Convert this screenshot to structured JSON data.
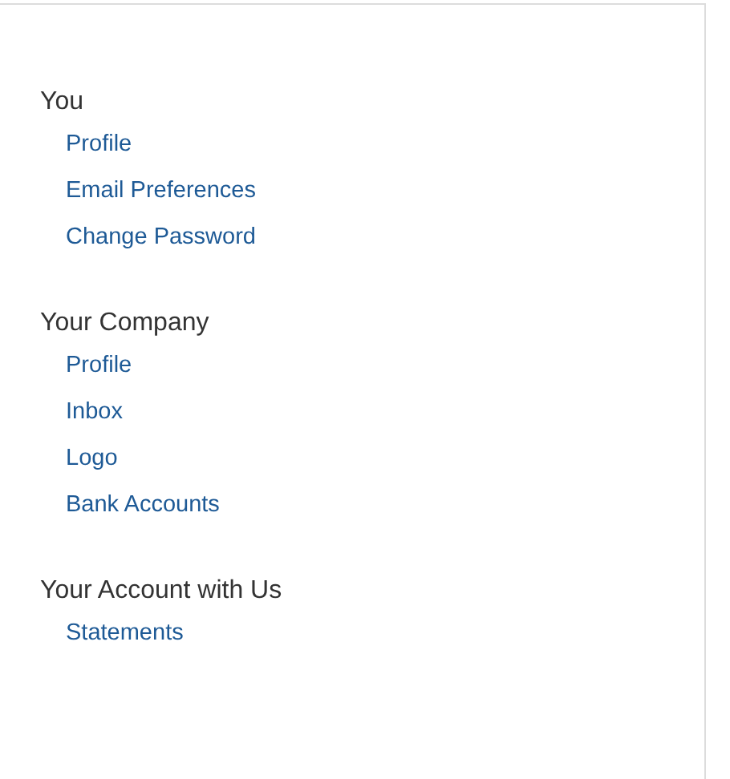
{
  "sections": [
    {
      "heading": "You",
      "links": [
        "Profile",
        "Email Preferences",
        "Change Password"
      ]
    },
    {
      "heading": "Your Company",
      "links": [
        "Profile",
        "Inbox",
        "Logo",
        "Bank Accounts"
      ]
    },
    {
      "heading": "Your Account with Us",
      "links": [
        "Statements"
      ]
    }
  ]
}
